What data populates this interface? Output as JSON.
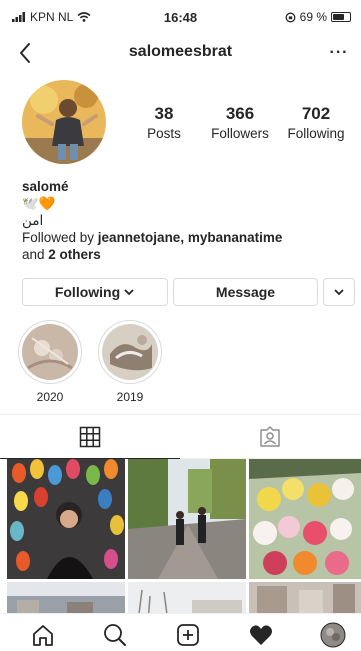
{
  "status_bar": {
    "carrier": "KPN NL",
    "time": "16:48",
    "battery_text": "69 %",
    "battery_level": 0.69
  },
  "header": {
    "title": "salomeesbrat",
    "more_glyph": "···"
  },
  "profile": {
    "avatar_icon": "profile-avatar",
    "stats": [
      {
        "count": "38",
        "label": "Posts"
      },
      {
        "count": "366",
        "label": "Followers"
      },
      {
        "count": "702",
        "label": "Following"
      }
    ],
    "name": "salomé",
    "emoji": "🕊️🧡",
    "bio_line": "امن",
    "followed_by_prefix": "Followed by ",
    "followed_by_users": "jeannetojane, mybananatime",
    "followed_by_and": "and ",
    "followed_by_others": "2 others"
  },
  "buttons": {
    "following": "Following",
    "message": "Message"
  },
  "highlights": [
    {
      "label": "2020"
    },
    {
      "label": "2019"
    }
  ],
  "tabs": {
    "grid_icon": "grid-icon",
    "tagged_icon": "tagged-icon"
  },
  "bottom_nav": [
    "home-icon",
    "search-icon",
    "new-post-icon",
    "activity-icon",
    "profile-icon"
  ],
  "colors": {
    "text": "#262626",
    "border": "#dbdbdb",
    "divider": "#efefef",
    "orange_heart": "#f39c2b"
  }
}
